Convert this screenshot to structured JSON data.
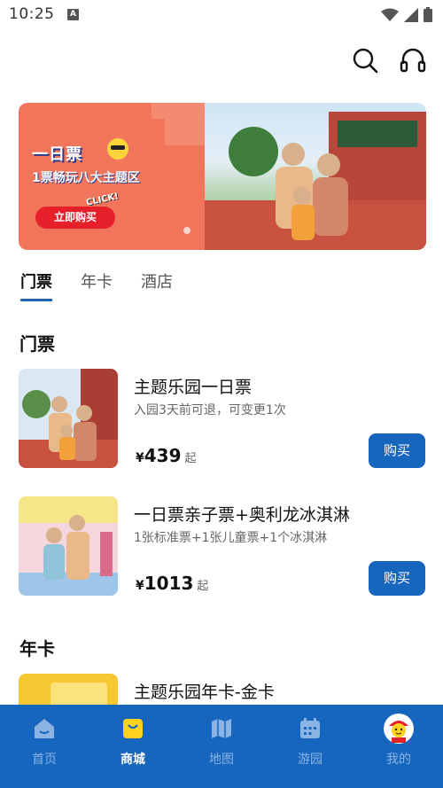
{
  "status_bar": {
    "time": "10:25",
    "notification_icon": "A"
  },
  "header": {
    "search_icon": "search-icon",
    "service_icon": "headset-icon"
  },
  "banner": {
    "title": "一日票",
    "subtitle": "1票畅玩八大主题区",
    "cta": "立即购买",
    "badge": "CLICK!",
    "brand_color": "#f0755a"
  },
  "tabs": [
    {
      "label": "门票",
      "active": true
    },
    {
      "label": "年卡",
      "active": false
    },
    {
      "label": "酒店",
      "active": false
    }
  ],
  "sections": {
    "tickets_title": "门票",
    "annual_title": "年卡"
  },
  "products": [
    {
      "name": "主题乐园一日票",
      "desc": "入园3天前可退，可变更1次",
      "currency": "¥",
      "price": "439",
      "price_suffix": "起",
      "buy_label": "购买"
    },
    {
      "name": "一日票亲子票+奥利龙冰淇淋",
      "desc": "1张标准票+1张儿童票+1个冰淇淋",
      "currency": "¥",
      "price": "1013",
      "price_suffix": "起",
      "buy_label": "购买"
    },
    {
      "name": "主题乐园年卡-金卡"
    }
  ],
  "bottom_nav": [
    {
      "label": "首页",
      "icon": "home-icon",
      "active": false
    },
    {
      "label": "商城",
      "icon": "shopping-bag-icon",
      "active": true
    },
    {
      "label": "地图",
      "icon": "map-icon",
      "active": false
    },
    {
      "label": "游园",
      "icon": "calendar-icon",
      "active": false
    },
    {
      "label": "我的",
      "icon": "avatar-icon",
      "active": false
    }
  ],
  "colors": {
    "accent": "#1766be",
    "banner": "#f0755a",
    "cta": "#e5202b"
  }
}
